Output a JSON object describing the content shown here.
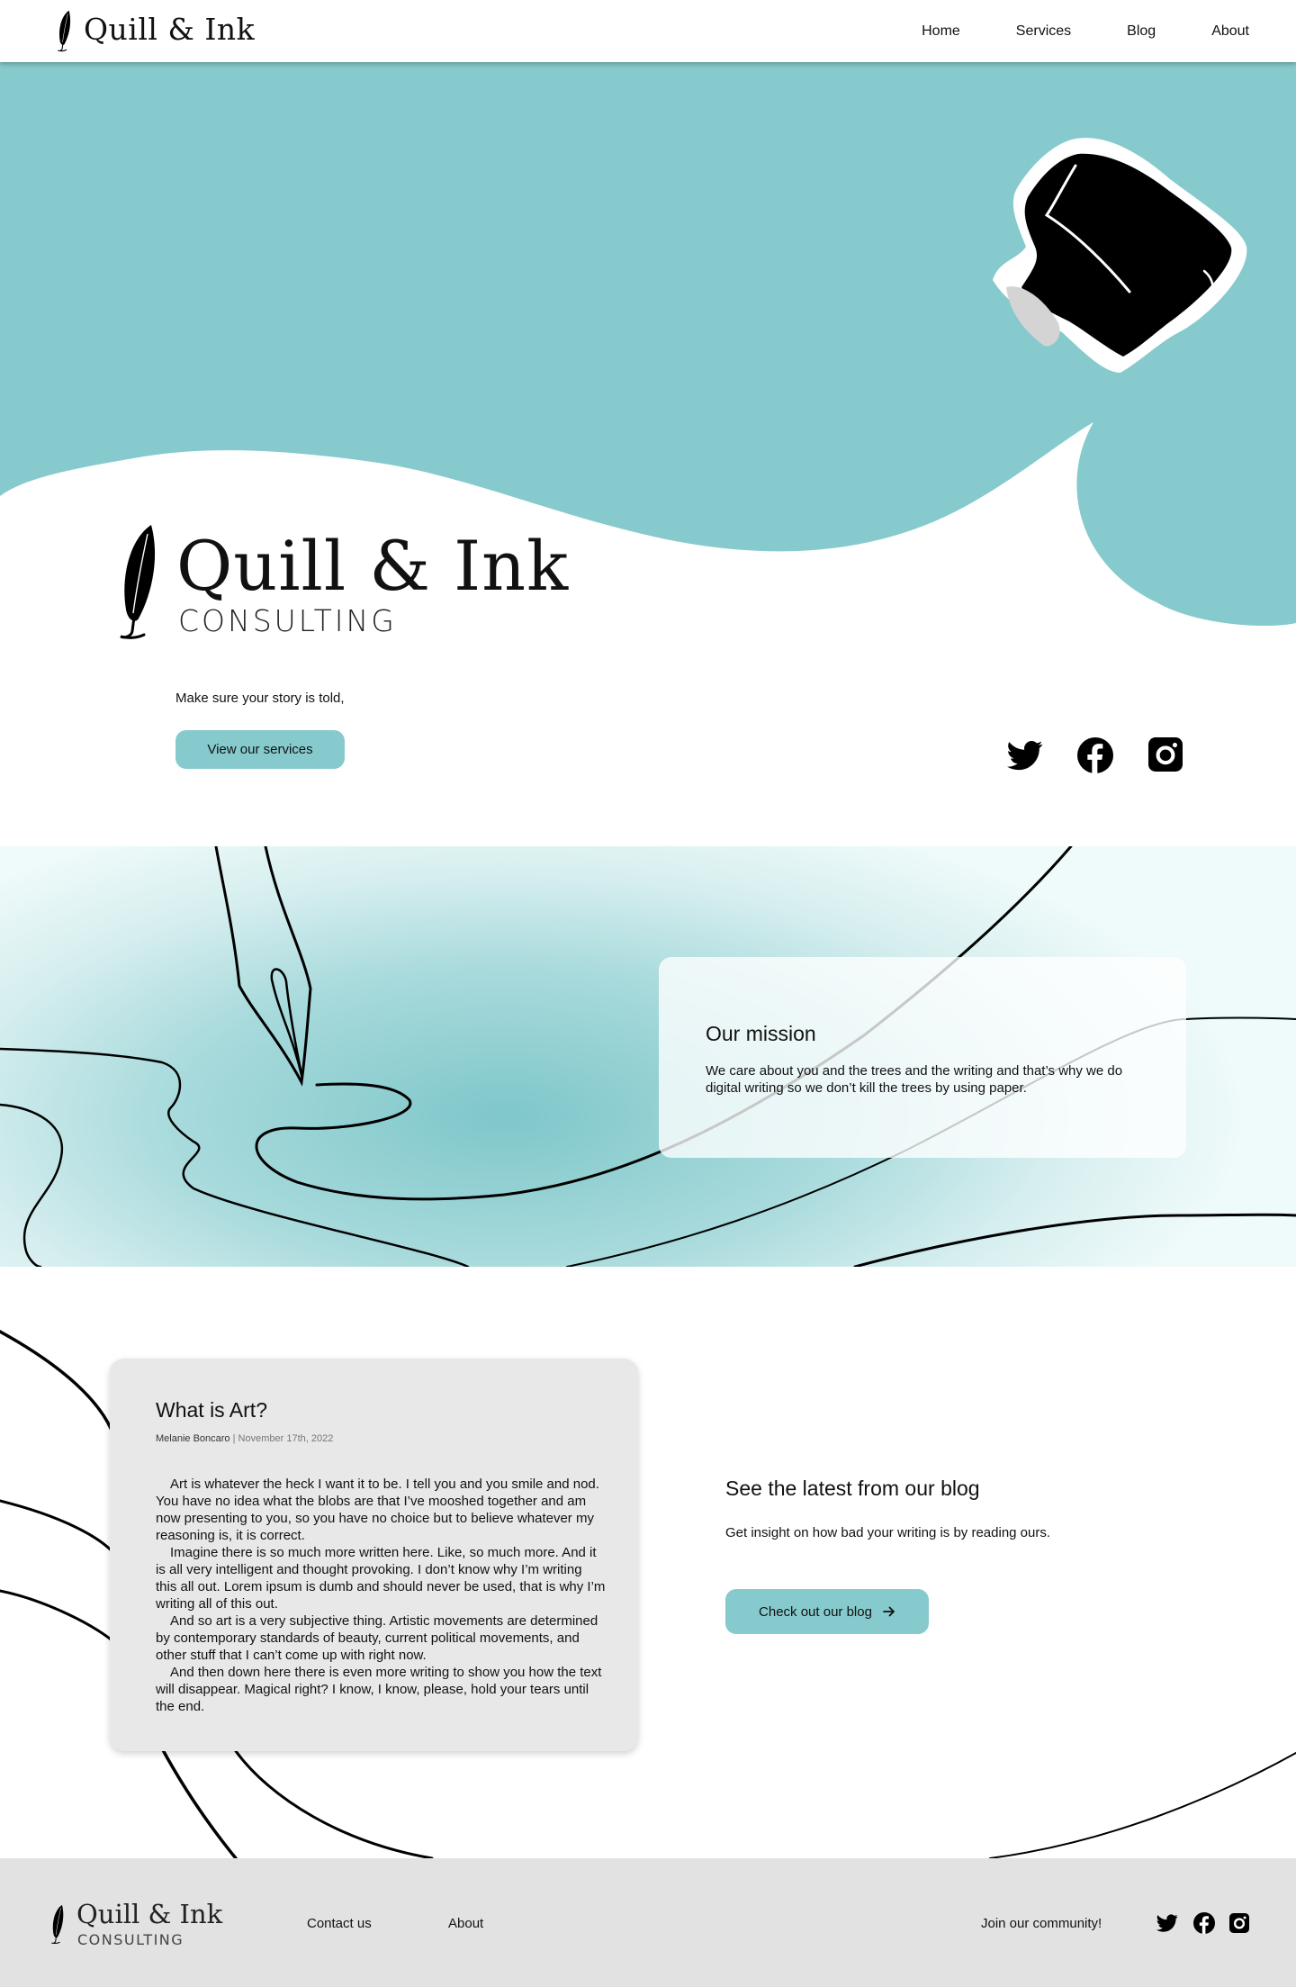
{
  "nav": {
    "brand": "Quill & Ink",
    "links": [
      "Home",
      "Services",
      "Blog",
      "About"
    ]
  },
  "hero": {
    "title": "Quill & Ink",
    "subtitle": "CONSULTING",
    "tagline": "Make sure your story is told,",
    "cta_label": "View our services",
    "social_icons": [
      "twitter-icon",
      "facebook-icon",
      "instagram-icon"
    ]
  },
  "mission": {
    "title": "Our mission",
    "text": "We care about you and the trees and the writing and that’s why we do digital writing so we don’t kill the trees by using paper."
  },
  "article": {
    "title": "What is Art?",
    "author": "Melanie Boncaro",
    "separator": "|",
    "date": "November 17th, 2022",
    "paragraphs": [
      "Art is whatever the heck I want it to be. I tell you and you smile and nod. You have no idea what the blobs are that I’ve mooshed together and am now presenting to you, so you have no choice but to believe whatever my reasoning is, it is correct.",
      "Imagine there is so much more written here. Like, so much more. And it is all very intelligent and thought provoking. I don’t know why I’m writing this all out. Lorem ipsum is dumb and should never be used, that is why I’m writing all of this out.",
      "And so art is a very subjective thing. Artistic movements are determined by contemporary standards of beauty, current political movements, and other stuff that I can’t come up with right now.",
      "And then down here there is even more writing to show you how the text will disappear. Magical right? I know, I know, please, hold your tears until the end."
    ]
  },
  "blog": {
    "heading": "See the latest from our blog",
    "text": "Get insight on how bad your writing is by reading ours.",
    "cta_label": "Check out our blog",
    "cta_icon": "arrow-right-icon"
  },
  "footer": {
    "brand": "Quill & Ink",
    "subtitle": "CONSULTING",
    "links": [
      "Contact us",
      "About"
    ],
    "community": "Join our community!",
    "social_icons": [
      "twitter-icon",
      "facebook-icon",
      "instagram-icon"
    ]
  },
  "colors": {
    "accent": "#86cacd",
    "footer_bg": "#e2e2e2",
    "card_bg": "#e8e8e8",
    "ink": "#000000"
  }
}
